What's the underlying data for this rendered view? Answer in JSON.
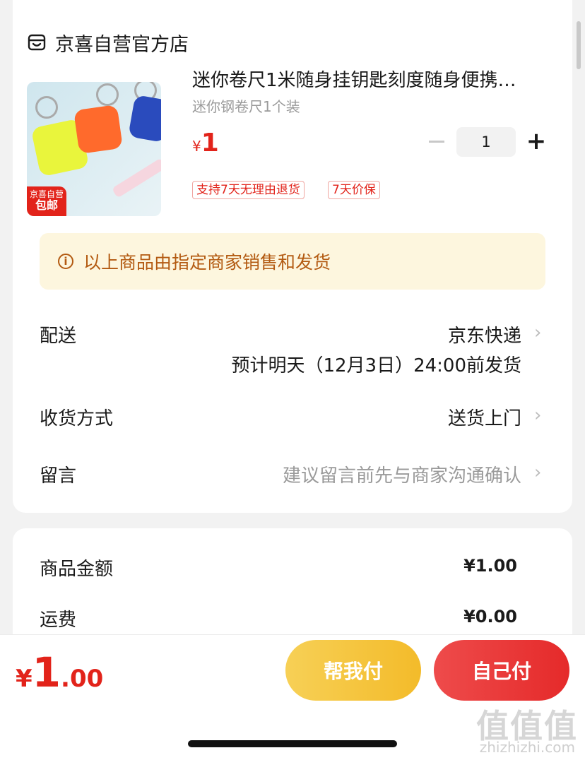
{
  "store": {
    "name": "京喜自营官方店",
    "icon": "store-icon"
  },
  "product": {
    "title": "迷你卷尺1米随身挂钥匙刻度随身便携…",
    "spec": "迷你钢卷尺1个装",
    "price_currency": "¥",
    "price_value": "1",
    "quantity": "1",
    "badge_line1": "京喜自营",
    "badge_line2": "包邮",
    "tags": [
      "支持7天无理由退货",
      "7天价保"
    ]
  },
  "notice": {
    "text": "以上商品由指定商家销售和发货",
    "icon": "info-icon"
  },
  "delivery": {
    "label": "配送",
    "value": "京东快递",
    "eta": "预计明天（12月3日）24:00前发货"
  },
  "receive_method": {
    "label": "收货方式",
    "value": "送货上门"
  },
  "message": {
    "label": "留言",
    "placeholder": "建议留言前先与商家沟通确认"
  },
  "summary": {
    "goods_label": "商品金额",
    "goods_value": "¥1.00",
    "shipping_label": "运费",
    "shipping_value": "¥0.00"
  },
  "footer": {
    "total_currency": "¥",
    "total_int": "1",
    "total_dec": ".00",
    "help_pay": "帮我付",
    "self_pay": "自己付"
  },
  "watermark": {
    "text": "值值值",
    "url": "zhizhizhi.com"
  },
  "colors": {
    "accent_red": "#e2231a",
    "notice_text": "#b35a11",
    "notice_bg": "#fdf6de",
    "help_btn": "#f3bb2a"
  }
}
